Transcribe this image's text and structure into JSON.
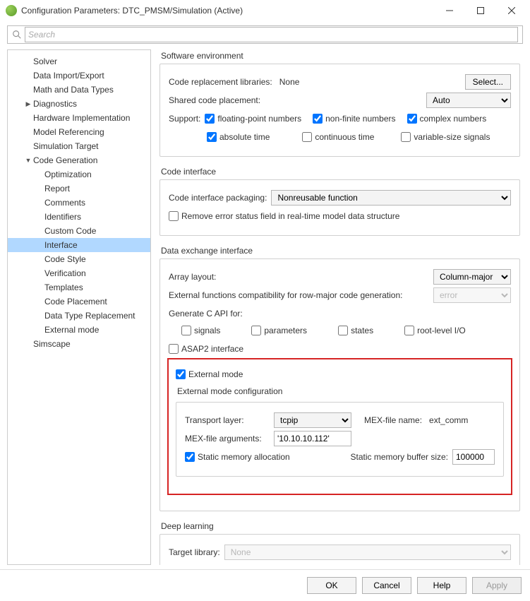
{
  "window": {
    "title": "Configuration Parameters: DTC_PMSM/Simulation (Active)"
  },
  "search": {
    "placeholder": "Search"
  },
  "tree": {
    "items": [
      {
        "label": "Solver",
        "depth": 1
      },
      {
        "label": "Data Import/Export",
        "depth": 1
      },
      {
        "label": "Math and Data Types",
        "depth": 1
      },
      {
        "label": "Diagnostics",
        "depth": 1,
        "expand": "▶"
      },
      {
        "label": "Hardware Implementation",
        "depth": 1
      },
      {
        "label": "Model Referencing",
        "depth": 1
      },
      {
        "label": "Simulation Target",
        "depth": 1
      },
      {
        "label": "Code Generation",
        "depth": 1,
        "expand": "▼"
      },
      {
        "label": "Optimization",
        "depth": 2
      },
      {
        "label": "Report",
        "depth": 2
      },
      {
        "label": "Comments",
        "depth": 2
      },
      {
        "label": "Identifiers",
        "depth": 2
      },
      {
        "label": "Custom Code",
        "depth": 2
      },
      {
        "label": "Interface",
        "depth": 2,
        "selected": true
      },
      {
        "label": "Code Style",
        "depth": 2
      },
      {
        "label": "Verification",
        "depth": 2
      },
      {
        "label": "Templates",
        "depth": 2
      },
      {
        "label": "Code Placement",
        "depth": 2
      },
      {
        "label": "Data Type Replacement",
        "depth": 2
      },
      {
        "label": "External mode",
        "depth": 2
      },
      {
        "label": "Simscape",
        "depth": 1
      }
    ]
  },
  "softenv": {
    "legend": "Software environment",
    "crl_label": "Code replacement libraries:",
    "crl_value": "None",
    "select_btn": "Select...",
    "scp_label": "Shared code placement:",
    "scp_value": "Auto",
    "support_label": "Support:",
    "fp": "floating-point numbers",
    "nf": "non-finite numbers",
    "cx": "complex numbers",
    "at": "absolute time",
    "ct": "continuous time",
    "vs": "variable-size signals"
  },
  "codeif": {
    "legend": "Code interface",
    "pkg_label": "Code interface packaging:",
    "pkg_value": "Nonreusable function",
    "remove_err": "Remove error status field in real-time model data structure"
  },
  "datax": {
    "legend": "Data exchange interface",
    "array_label": "Array layout:",
    "array_value": "Column-major",
    "extfunc_label": "External functions compatibility for row-major code generation:",
    "extfunc_value": "error",
    "capi_label": "Generate C API for:",
    "capi_signals": "signals",
    "capi_params": "parameters",
    "capi_states": "states",
    "capi_root": "root-level I/O",
    "asap2": "ASAP2 interface",
    "extmode": "External mode",
    "extmode_cfg": "External mode configuration",
    "tlayer_label": "Transport layer:",
    "tlayer_value": "tcpip",
    "mexname_label": "MEX-file name:",
    "mexname_value": "ext_comm",
    "mexargs_label": "MEX-file arguments:",
    "mexargs_value": "'10.10.10.112'",
    "staticmem": "Static memory allocation",
    "bufsize_label": "Static memory buffer size:",
    "bufsize_value": "100000"
  },
  "deep": {
    "legend": "Deep learning",
    "target_label": "Target library:",
    "target_value": "None"
  },
  "more": "...",
  "footer": {
    "ok": "OK",
    "cancel": "Cancel",
    "help": "Help",
    "apply": "Apply"
  }
}
